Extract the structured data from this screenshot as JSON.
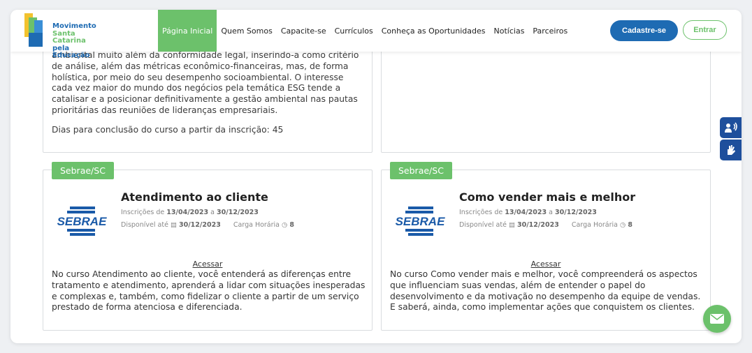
{
  "header": {
    "brand": {
      "line1": "Movimento",
      "line2": "Santa Catarina",
      "line3": "pela Educação"
    },
    "nav": [
      "Página Inicial",
      "Quem Somos",
      "Capacite-se",
      "Currículos",
      "Conheça as Oportunidades",
      "Notícias",
      "Parceiros"
    ],
    "register_label": "Cadastre-se",
    "login_label": "Entrar"
  },
  "top_left_card": {
    "text": "ambiental muito além da conformidade legal, inserindo-a como critério de análise, além das métricas econômico-financeiras, mas, de forma holística, por meio do seu desempenho socioambiental. O interesse cada vez maior do mundo dos negócios pela temática ESG tende a catalisar e a posicionar definitivamente a gestão ambiental nas pautas prioritárias das reuniões de lideranças empresariais.",
    "days": "Dias para conclusão do curso a partir da inscrição: 45"
  },
  "courses": [
    {
      "badge": "Sebrae/SC",
      "logo": "SEBRAE",
      "title": "Atendimento ao cliente",
      "insc_prefix": "Inscrições de",
      "insc_start": "13/04/2023",
      "insc_sep": "a",
      "insc_end": "30/12/2023",
      "avail_label": "Disponível até",
      "avail_date": "30/12/2023",
      "load_label": "Carga Horária",
      "load_value": "8",
      "access": "Acessar",
      "description": "No curso Atendimento ao cliente, você entenderá as diferenças entre tratamento e atendimento, aprenderá a lidar com situações inesperadas e complexas e, também, como fidelizar o cliente a partir de um serviço prestado de forma atenciosa e diferenciada."
    },
    {
      "badge": "Sebrae/SC",
      "logo": "SEBRAE",
      "title": "Como vender mais e melhor",
      "insc_prefix": "Inscrições de",
      "insc_start": "13/04/2023",
      "insc_sep": "a",
      "insc_end": "30/12/2023",
      "avail_label": "Disponível até",
      "avail_date": "30/12/2023",
      "load_label": "Carga Horária",
      "load_value": "8",
      "access": "Acessar",
      "description": "No curso Como vender mais e melhor, você compreenderá os aspectos que influenciam suas vendas, além de entender o papel do desenvolvimento e da motivação no desempenho da equipe de vendas. E saberá, ainda, como implementar ações que conquistem os clientes."
    }
  ],
  "colors": {
    "green": "#6cc16b",
    "blue": "#1e6bb3",
    "navy": "#1e4f9c"
  }
}
